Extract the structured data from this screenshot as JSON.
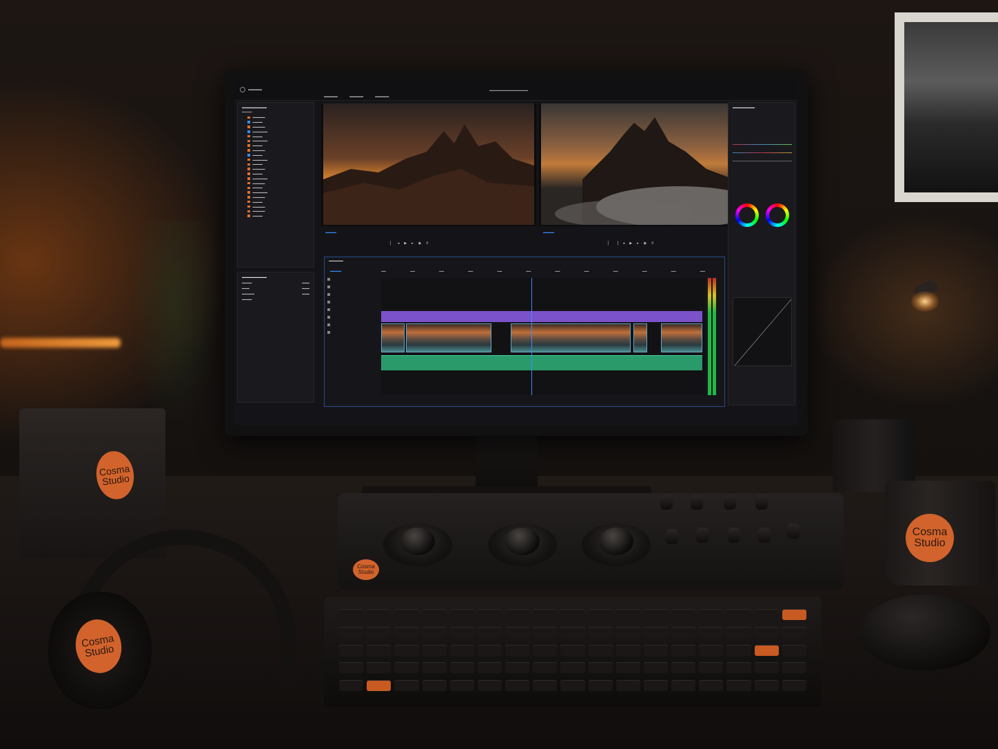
{
  "brand": {
    "logo_text_line1": "Cosma",
    "logo_text_line2": "Studio",
    "accent": "#d2632c"
  },
  "scene": {
    "objects": [
      "monitor",
      "control-surface",
      "keyboard",
      "headphones",
      "mug",
      "mouse",
      "external-drive",
      "desk-lamp",
      "pen-cup",
      "framed-photo",
      "plant"
    ]
  },
  "editor": {
    "app_icon": "app-logo-icon",
    "colors": {
      "playhead": "#3c8cff",
      "video_track_v2": "#7b52c9",
      "audio_track": "#2a9a6a"
    },
    "viewer_icons": [
      "play-icon",
      "step-back-icon",
      "step-forward-icon",
      "mark-in-icon",
      "mark-out-icon",
      "camera-icon",
      "zoom-icon"
    ],
    "inspector_wheels": 2,
    "audio_meter_channels": 2
  }
}
